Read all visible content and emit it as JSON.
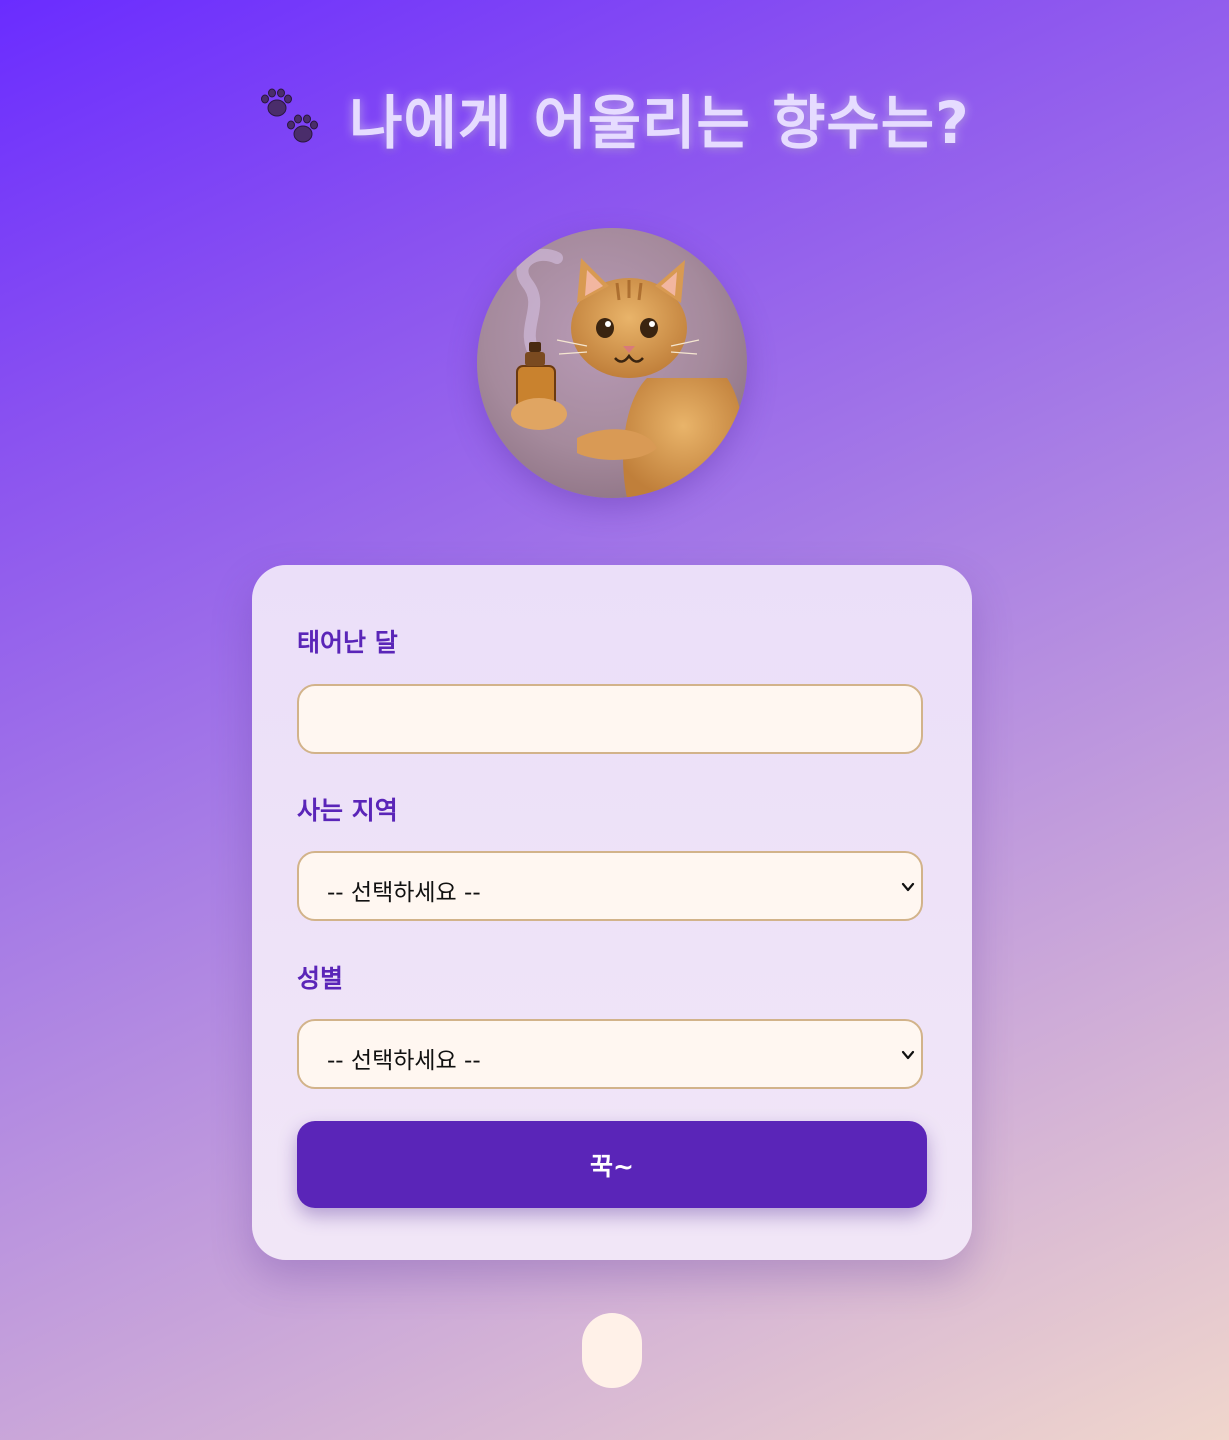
{
  "header": {
    "title": "나에게 어울리는 향수는?",
    "icon": "paw-prints-icon"
  },
  "avatar": {
    "icon": "cat-with-perfume-illustration"
  },
  "form": {
    "birth_month": {
      "label": "태어난 달",
      "value": ""
    },
    "region": {
      "label": "사는 지역",
      "selected": "-- 선택하세요 --"
    },
    "gender": {
      "label": "성별",
      "selected": "-- 선택하세요 --"
    },
    "submit_label": "꾹~"
  },
  "colors": {
    "accent": "#5a25b8",
    "field_bg": "#fff7f1",
    "field_border": "#d2b38a",
    "card_bg": "#ebdff9"
  }
}
